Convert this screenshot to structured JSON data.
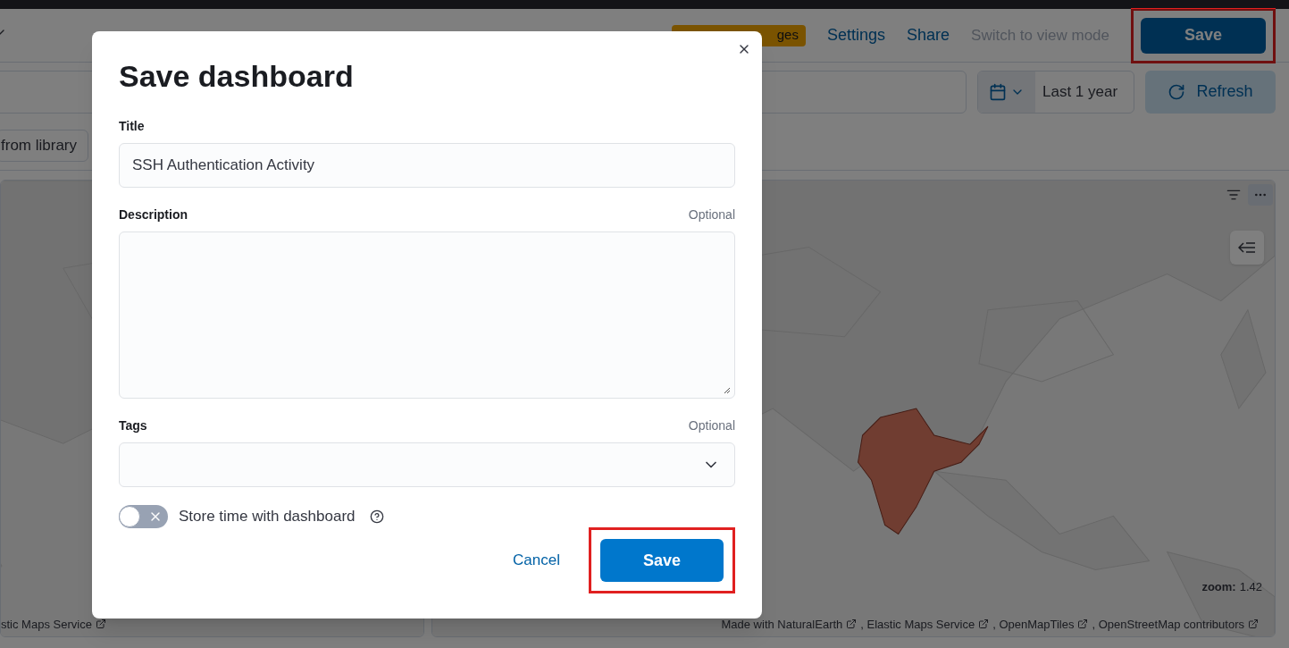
{
  "header": {
    "badge": "ges",
    "links": [
      "Settings",
      "Share"
    ],
    "switch_mode": "Switch to view mode",
    "save": {
      "label": "Save",
      "highlighted": true
    }
  },
  "query_bar": {
    "date_range": "Last 1 year",
    "refresh": "Refresh"
  },
  "library_button": "from library",
  "map_panels": [
    {
      "attribution": [
        "stic Maps Service"
      ]
    },
    {
      "zoom_label": "zoom:",
      "zoom_value": "1.42",
      "attribution": [
        "Made with NaturalEarth",
        ", Elastic Maps Service",
        ", OpenMapTiles",
        ", OpenStreetMap contributors"
      ]
    }
  ],
  "dialog": {
    "title": "Save dashboard",
    "fields": [
      {
        "kind": "text",
        "label": "Title",
        "value": "SSH Authentication Activity"
      },
      {
        "kind": "textarea",
        "label": "Description",
        "optional": "Optional"
      },
      {
        "kind": "select",
        "label": "Tags",
        "optional": "Optional"
      }
    ],
    "toggle": {
      "label": "Store time with dashboard",
      "on": false
    },
    "cancel": "Cancel",
    "save": {
      "label": "Save",
      "highlighted": true
    }
  }
}
